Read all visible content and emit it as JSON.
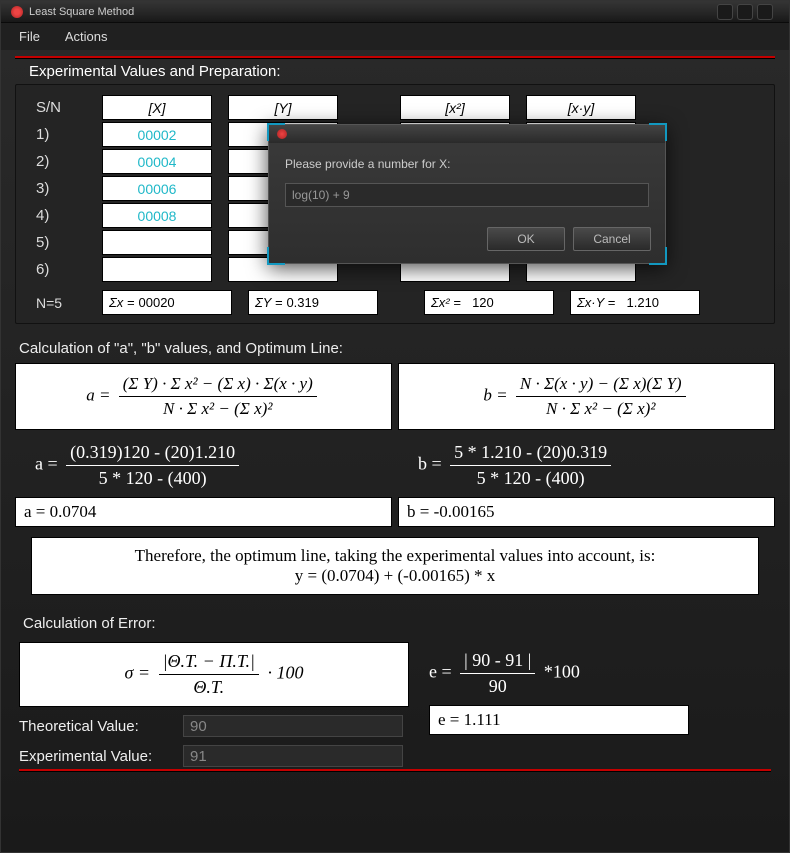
{
  "window": {
    "title": "Least Square Method"
  },
  "menu": {
    "file": "File",
    "actions": "Actions"
  },
  "section1": {
    "title": "Experimental Values and Preparation:"
  },
  "headers": {
    "sn": "S/N",
    "x": "[X]",
    "y": "[Y]",
    "x2": "[x²]",
    "xy": "[x·y]"
  },
  "rows": [
    {
      "sn": "1)",
      "x": "00002"
    },
    {
      "sn": "2)",
      "x": "00004"
    },
    {
      "sn": "3)",
      "x": "00006"
    },
    {
      "sn": "4)",
      "x": "00008"
    },
    {
      "sn": "5)",
      "x": ""
    },
    {
      "sn": "6)",
      "x": ""
    }
  ],
  "summary": {
    "n_label": "N=5",
    "sumx_label": "Σx =",
    "sumx": "00020",
    "sumy_label": "ΣY =",
    "sumy": "0.319",
    "sumx2_label": "Σx² =",
    "sumx2": "120",
    "sumxy_label": "Σx·Y =",
    "sumxy": "1.210"
  },
  "section2": {
    "title": "Calculation of \"a\", \"b\" values, and Optimum Line:"
  },
  "formula_a": {
    "lhs": "a =",
    "num": "(Σ Y) · Σ x² − (Σ x) · Σ(x · y)",
    "den": "N · Σ x² − (Σ x)²"
  },
  "formula_b": {
    "lhs": "b =",
    "num": "N · Σ(x · y) − (Σ x)(Σ Y)",
    "den": "N · Σ x² − (Σ x)²"
  },
  "calc_a": {
    "lhs": "a =",
    "num": "(0.319)120 - (20)1.210",
    "den": "5 * 120 - (400)"
  },
  "calc_b": {
    "lhs": "b =",
    "num": "5 * 1.210 - (20)0.319",
    "den": "5 * 120 - (400)"
  },
  "result_a": "a = 0.0704",
  "result_b": "b = -0.00165",
  "optimum": {
    "line1": "Therefore, the optimum line, taking the experimental values into account, is:",
    "line2": "y = (0.0704) + (-0.00165) * x"
  },
  "section3": {
    "title": "Calculation of Error:"
  },
  "error_formula": {
    "lhs": "σ =",
    "num": "|Θ.Τ. − Π.Τ.|",
    "den": "Θ.Τ.",
    "suffix": "· 100"
  },
  "error_calc": {
    "lhs": "e =",
    "num": "| 90 - 91 |",
    "den": "90",
    "suffix": "*100"
  },
  "theo": {
    "label": "Theoretical Value:",
    "value": "90"
  },
  "exp": {
    "label": "Experimental Value:",
    "value": "91"
  },
  "error_result": "e = 1.111",
  "dialog": {
    "prompt": "Please provide a number for X:",
    "value": "log(10) + 9",
    "ok": "OK",
    "cancel": "Cancel"
  }
}
